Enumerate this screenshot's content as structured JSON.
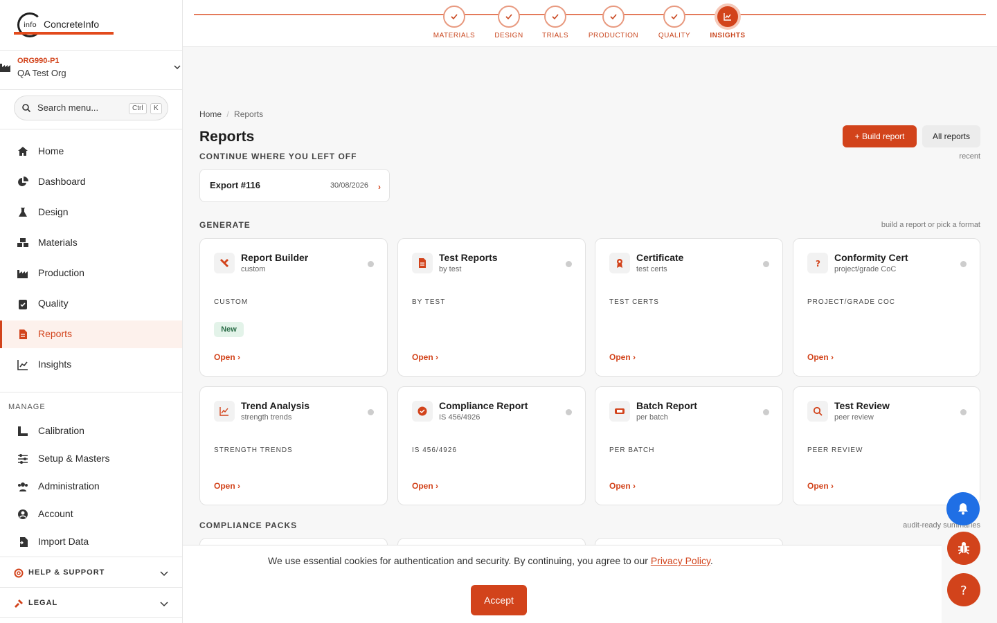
{
  "brand": {
    "name": "ConcreteInfo",
    "mark": "info"
  },
  "org": {
    "code": "ORG990-P1",
    "name": "QA Test Org"
  },
  "search": {
    "placeholder": "Search menu...",
    "kbd1": "Ctrl",
    "kbd2": "K"
  },
  "nav": [
    {
      "label": "Home",
      "icon": "home-icon"
    },
    {
      "label": "Dashboard",
      "icon": "pie-chart-icon"
    },
    {
      "label": "Design",
      "icon": "flask-icon"
    },
    {
      "label": "Materials",
      "icon": "cubes-icon"
    },
    {
      "label": "Production",
      "icon": "factory-icon"
    },
    {
      "label": "Quality",
      "icon": "clipboard-check-icon"
    },
    {
      "label": "Reports",
      "icon": "file-icon",
      "active": true
    },
    {
      "label": "Insights",
      "icon": "line-chart-icon"
    }
  ],
  "manage": {
    "label": "MANAGE",
    "items": [
      {
        "label": "Calibration",
        "icon": "ruler-icon"
      },
      {
        "label": "Setup & Masters",
        "icon": "sliders-icon"
      },
      {
        "label": "Administration",
        "icon": "users-icon"
      },
      {
        "label": "Account",
        "icon": "user-circle-icon"
      },
      {
        "label": "Import Data",
        "icon": "file-import-icon"
      }
    ]
  },
  "footer": {
    "help": "HELP & SUPPORT",
    "legal": "LEGAL"
  },
  "stepper": [
    {
      "label": "MATERIALS",
      "done": true
    },
    {
      "label": "DESIGN",
      "done": true
    },
    {
      "label": "TRIALS",
      "done": true
    },
    {
      "label": "PRODUCTION",
      "done": true
    },
    {
      "label": "QUALITY",
      "done": true
    },
    {
      "label": "INSIGHTS",
      "active": true
    }
  ],
  "breadcrumb": {
    "home": "Home",
    "sep": "/",
    "current": "Reports"
  },
  "page": {
    "title": "Reports",
    "build_button": "Build report",
    "all_button": "All reports",
    "recent_hint": "recent"
  },
  "continue": {
    "label": "CONTINUE WHERE YOU LEFT OFF",
    "item": {
      "name": "Export #116",
      "date": "30/08/2026"
    }
  },
  "generate": {
    "label": "GENERATE",
    "hint": "build a report or pick a format",
    "cards": [
      {
        "title": "Report Builder",
        "sub": "custom",
        "caption": "CUSTOM",
        "badge": "New",
        "open": "Open ›",
        "icon": "tools-icon"
      },
      {
        "title": "Test Reports",
        "sub": "by test",
        "caption": "BY TEST",
        "open": "Open ›",
        "icon": "file-icon"
      },
      {
        "title": "Certificate",
        "sub": "test certs",
        "caption": "TEST CERTS",
        "open": "Open ›",
        "icon": "award-icon"
      },
      {
        "title": "Conformity Cert",
        "sub": "project/grade CoC",
        "caption": "PROJECT/GRADE COC",
        "open": "Open ›",
        "icon": "question-icon"
      },
      {
        "title": "Trend Analysis",
        "sub": "strength trends",
        "caption": "STRENGTH TRENDS",
        "open": "Open ›",
        "icon": "line-chart-icon"
      },
      {
        "title": "Compliance Report",
        "sub": "IS 456/4926",
        "caption": "IS 456/4926",
        "open": "Open ›",
        "icon": "check-circle-icon"
      },
      {
        "title": "Batch Report",
        "sub": "per batch",
        "caption": "PER BATCH",
        "open": "Open ›",
        "icon": "ticket-icon"
      },
      {
        "title": "Test Review",
        "sub": "peer review",
        "caption": "PEER REVIEW",
        "open": "Open ›",
        "icon": "search-icon"
      }
    ]
  },
  "compliance": {
    "label": "COMPLIANCE PACKS",
    "hint": "audit-ready summaries"
  },
  "cookie": {
    "text": "We use essential cookies for authentication and security. By continuing, you agree to our",
    "link": "Privacy Policy",
    "end": ".",
    "accept": "Accept"
  },
  "colors": {
    "accent": "#d2431b",
    "blue": "#1f6fe5",
    "bg": "#f7f7f7"
  }
}
